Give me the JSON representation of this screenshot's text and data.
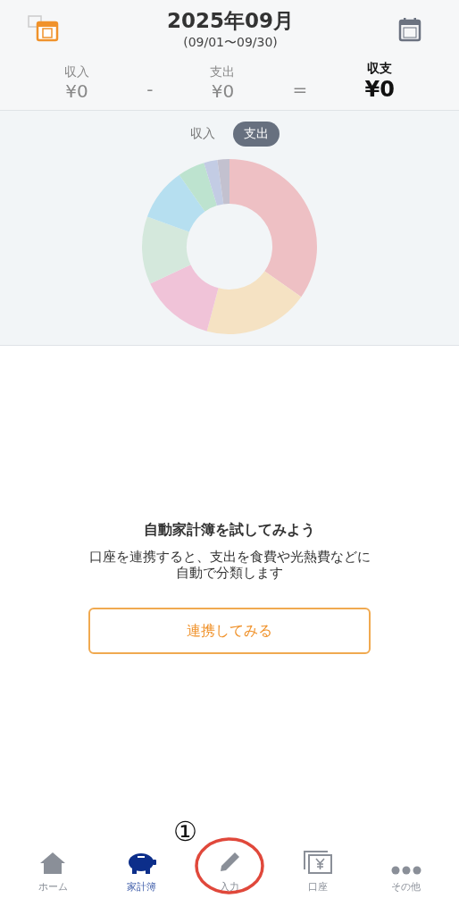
{
  "header": {
    "title": "2025年09月",
    "range": "(09/01〜09/30)"
  },
  "summary": [
    {
      "kind": "value",
      "label": "収入",
      "amount": "¥0",
      "emphasis": false
    },
    {
      "kind": "operator",
      "symbol": "-"
    },
    {
      "kind": "value",
      "label": "支出",
      "amount": "¥0",
      "emphasis": false
    },
    {
      "kind": "operator",
      "symbol": "="
    },
    {
      "kind": "value",
      "label": "収支",
      "amount": "¥0",
      "emphasis": true
    }
  ],
  "chart_tabs": [
    {
      "label": "収入",
      "selected": false
    },
    {
      "label": "支出",
      "selected": true
    }
  ],
  "promo": {
    "title": "自動家計簿を試してみよう",
    "body": "口座を連携すると、支出を食費や光熱費などに自動で分類します",
    "button": "連携してみる"
  },
  "annotation": {
    "mark": "①"
  },
  "nav": [
    {
      "kind": "home",
      "label": "ホーム",
      "selected": false,
      "circled": false
    },
    {
      "kind": "piggy",
      "label": "家計簿",
      "selected": true,
      "circled": false
    },
    {
      "kind": "pencil",
      "label": "入力",
      "selected": false,
      "circled": true
    },
    {
      "kind": "account",
      "label": "口座",
      "selected": false,
      "circled": false
    },
    {
      "kind": "more",
      "label": "その他",
      "selected": false,
      "circled": false
    }
  ]
}
